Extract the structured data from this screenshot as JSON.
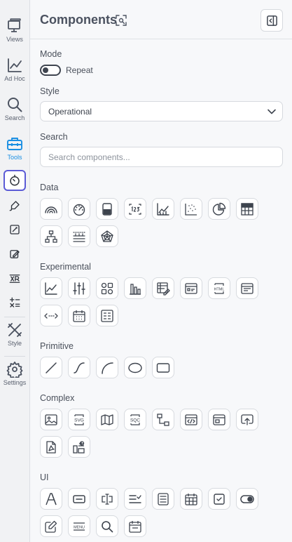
{
  "rail": {
    "items": [
      {
        "label": "Views",
        "icon": "monitor-icon"
      },
      {
        "label": "Ad Hoc",
        "icon": "trending-chart-icon"
      },
      {
        "label": "Search",
        "icon": "search-icon"
      },
      {
        "label": "Tools",
        "icon": "toolbox-icon"
      },
      {
        "label": "Style",
        "icon": "paint-tools-icon"
      },
      {
        "label": "Settings",
        "icon": "gear-icon"
      }
    ],
    "active_color": "#1a8fe3",
    "selected_outline_color": "#5b5bd6"
  },
  "panel": {
    "title": "Components",
    "mode": {
      "label": "Mode",
      "toggle_label": "Repeat",
      "toggle_on": false
    },
    "style": {
      "label": "Style",
      "value": "Operational"
    },
    "search": {
      "label": "Search",
      "placeholder": "Search components..."
    },
    "sections": [
      {
        "title": "Data",
        "icons": [
          "arc-gauge-icon",
          "speedometer-icon",
          "tank-gauge-icon",
          "numeric-display-icon",
          "line-chart-icon",
          "scatter-plot-icon",
          "pie-chart-icon",
          "table-grid-icon",
          "tree-hierarchy-icon",
          "timeseries-icon",
          "radar-chart-icon"
        ]
      },
      {
        "title": "Experimental",
        "icons": [
          "trend-chart-icon",
          "equalizer-icon",
          "device-grid-icon",
          "bar-chart-icon",
          "pivot-table-icon",
          "form-icon",
          "html-icon",
          "report-icon",
          "spacer-icon",
          "calendar-grid-icon",
          "matrix-icon"
        ]
      },
      {
        "title": "Primitive",
        "icons": [
          "line-icon",
          "curve-icon",
          "arc-icon",
          "ellipse-icon",
          "rectangle-icon"
        ]
      },
      {
        "title": "Complex",
        "icons": [
          "image-icon",
          "svg-icon",
          "map-icon",
          "sqc-icon",
          "flowchart-icon",
          "code-embed-icon",
          "window-icon",
          "upload-icon",
          "pdf-icon",
          "dashboard-icon"
        ]
      },
      {
        "title": "UI",
        "icons": [
          "typography-icon",
          "button-icon",
          "text-input-icon",
          "list-check-icon",
          "text-area-icon",
          "calendar-icon",
          "checkbox-icon",
          "toggle-icon",
          "edit-icon",
          "menu-icon",
          "search-icon",
          "date-picker-icon"
        ]
      }
    ]
  }
}
